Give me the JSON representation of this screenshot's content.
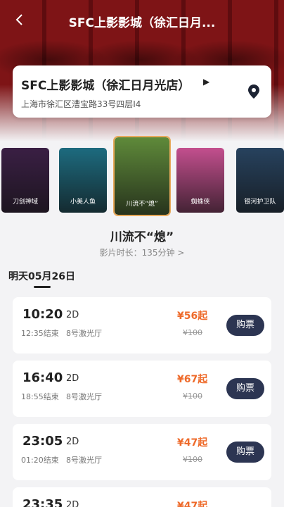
{
  "header": {
    "title": "SFC上影影城（徐汇日月..."
  },
  "cinema": {
    "name": "SFC上影影城（徐汇日月光店）",
    "address": "上海市徐汇区漕宝路33号四层I4",
    "arrow": "▶"
  },
  "posters": [
    {
      "label": "刀剑神域",
      "bg": "#3a1f44"
    },
    {
      "label": "小美人鱼",
      "bg": "#1d6b7f"
    },
    {
      "label": "川流不“熄”",
      "bg": "#5f8a3a"
    },
    {
      "label": "蜘蛛侠",
      "bg": "#c34f8e"
    },
    {
      "label": "银河护卫队",
      "bg": "#27425e"
    }
  ],
  "movie": {
    "title": "川流不“熄”",
    "duration": "影片时长：135分钟 >"
  },
  "date_tab": {
    "label": "明天05月26日"
  },
  "showtimes": [
    {
      "time": "10:20",
      "end": "12:35结束",
      "format": "2D",
      "hall": "8号激光厅",
      "price": "¥56起",
      "original": "¥100",
      "buy": "购票"
    },
    {
      "time": "16:40",
      "end": "18:55结束",
      "format": "2D",
      "hall": "8号激光厅",
      "price": "¥67起",
      "original": "¥100",
      "buy": "购票"
    },
    {
      "time": "23:05",
      "end": "01:20结束",
      "format": "2D",
      "hall": "8号激光厅",
      "price": "¥47起",
      "original": "¥100",
      "buy": "购票"
    },
    {
      "time": "23:35",
      "end": "",
      "format": "2D",
      "hall": "",
      "price": "¥47起",
      "original": "",
      "buy": ""
    }
  ],
  "colors": {
    "accent_price": "#ee6a2a",
    "buy_button": "#2c3552",
    "poster_highlight": "#e8a95b"
  },
  "icons": {
    "back": "chevron-left-icon",
    "location": "map-pin-icon"
  }
}
